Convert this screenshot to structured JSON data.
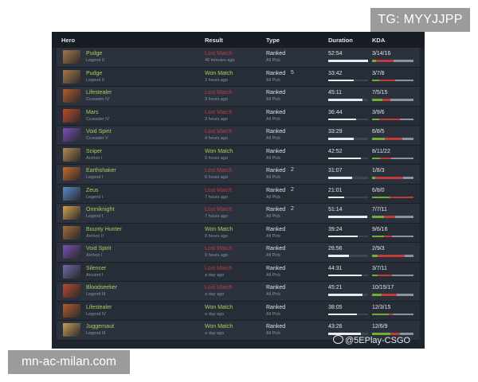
{
  "badges": {
    "tg": "TG: MYYJJPP",
    "site": "mn-ac-milan.com"
  },
  "watermark": "@5EPlay-CSGO",
  "table": {
    "headers": {
      "hero": "Hero",
      "result": "Result",
      "type": "Type",
      "duration": "Duration",
      "kda": "KDA"
    },
    "rows": [
      {
        "hero": "Pudge",
        "rank": "Legend II",
        "result": "Lost Match",
        "won": false,
        "when": "40 minutes ago",
        "type": "Ranked",
        "mode": "All Pick",
        "party": "",
        "duration": "52:54",
        "dur_frac": 1.0,
        "kda": "3/14/16",
        "k": 3,
        "d": 14,
        "a": 16,
        "color": "#a7774d"
      },
      {
        "hero": "Pudge",
        "rank": "Legend II",
        "result": "Won Match",
        "won": true,
        "when": "2 hours ago",
        "type": "Ranked",
        "mode": "All Pick",
        "party": "5",
        "duration": "33:42",
        "dur_frac": 0.64,
        "kda": "3/7/8",
        "k": 3,
        "d": 7,
        "a": 8,
        "color": "#a7774d"
      },
      {
        "hero": "Lifestealer",
        "rank": "Crusader IV",
        "result": "Lost Match",
        "won": false,
        "when": "3 hours ago",
        "type": "Ranked",
        "mode": "All Pick",
        "party": "",
        "duration": "45:11",
        "dur_frac": 0.85,
        "kda": "7/5/15",
        "k": 7,
        "d": 5,
        "a": 15,
        "color": "#b35a2c"
      },
      {
        "hero": "Mars",
        "rank": "Crusader IV",
        "result": "Lost Match",
        "won": false,
        "when": "3 hours ago",
        "type": "Ranked",
        "mode": "All Pick",
        "party": "",
        "duration": "36:44",
        "dur_frac": 0.69,
        "kda": "3/9/6",
        "k": 3,
        "d": 9,
        "a": 6,
        "color": "#c14a2a"
      },
      {
        "hero": "Void Spirit",
        "rank": "Crusader V",
        "result": "Lost Match",
        "won": false,
        "when": "4 hours ago",
        "type": "Ranked",
        "mode": "All Pick",
        "party": "",
        "duration": "33:29",
        "dur_frac": 0.63,
        "kda": "6/8/5",
        "k": 6,
        "d": 8,
        "a": 5,
        "color": "#7a4fb8"
      },
      {
        "hero": "Sniper",
        "rank": "Archon I",
        "result": "Won Match",
        "won": true,
        "when": "5 hours ago",
        "type": "Ranked",
        "mode": "All Pick",
        "party": "",
        "duration": "42:52",
        "dur_frac": 0.81,
        "kda": "8/11/22",
        "k": 8,
        "d": 11,
        "a": 22,
        "color": "#b38a56"
      },
      {
        "hero": "Earthshaker",
        "rank": "Legend I",
        "result": "Lost Match",
        "won": false,
        "when": "6 hours ago",
        "type": "Ranked",
        "mode": "All Pick",
        "party": "2",
        "duration": "31:07",
        "dur_frac": 0.59,
        "kda": "1/8/3",
        "k": 1,
        "d": 8,
        "a": 3,
        "color": "#c46b2c"
      },
      {
        "hero": "Zeus",
        "rank": "Legend I",
        "result": "Lost Match",
        "won": false,
        "when": "7 hours ago",
        "type": "Ranked",
        "mode": "All Pick",
        "party": "2",
        "duration": "21:01",
        "dur_frac": 0.4,
        "kda": "6/8/0",
        "k": 6,
        "d": 8,
        "a": 0,
        "color": "#5a8ac9"
      },
      {
        "hero": "Omniknight",
        "rank": "Legend I",
        "result": "Lost Match",
        "won": false,
        "when": "7 hours ago",
        "type": "Ranked",
        "mode": "All Pick",
        "party": "2",
        "duration": "51:14",
        "dur_frac": 0.97,
        "kda": "7/7/11",
        "k": 7,
        "d": 7,
        "a": 11,
        "color": "#d1a04e"
      },
      {
        "hero": "Bounty Hunter",
        "rank": "Archon II",
        "result": "Won Match",
        "won": true,
        "when": "8 hours ago",
        "type": "Ranked",
        "mode": "All Pick",
        "party": "",
        "duration": "39:24",
        "dur_frac": 0.74,
        "kda": "9/6/16",
        "k": 9,
        "d": 6,
        "a": 16,
        "color": "#a36a3a"
      },
      {
        "hero": "Void Spirit",
        "rank": "Archon I",
        "result": "Lost Match",
        "won": false,
        "when": "9 hours ago",
        "type": "Ranked",
        "mode": "All Pick",
        "party": "",
        "duration": "26:56",
        "dur_frac": 0.51,
        "kda": "2/9/3",
        "k": 2,
        "d": 9,
        "a": 3,
        "color": "#7a4fb8"
      },
      {
        "hero": "Silencer",
        "rank": "Ancient I",
        "result": "Lost Match",
        "won": false,
        "when": "a day ago",
        "type": "Ranked",
        "mode": "All Pick",
        "party": "",
        "duration": "44:31",
        "dur_frac": 0.84,
        "kda": "3/7/11",
        "k": 3,
        "d": 7,
        "a": 11,
        "color": "#6d6aa8"
      },
      {
        "hero": "Bloodseeker",
        "rank": "Legend III",
        "result": "Lost Match",
        "won": false,
        "when": "a day ago",
        "type": "Ranked",
        "mode": "All Pick",
        "party": "",
        "duration": "45:21",
        "dur_frac": 0.86,
        "kda": "10/15/17",
        "k": 10,
        "d": 15,
        "a": 17,
        "color": "#b8492e"
      },
      {
        "hero": "Lifestealer",
        "rank": "Legend IV",
        "result": "Won Match",
        "won": true,
        "when": "a day ago",
        "type": "Ranked",
        "mode": "All Pick",
        "party": "",
        "duration": "38:05",
        "dur_frac": 0.72,
        "kda": "12/3/15",
        "k": 12,
        "d": 3,
        "a": 15,
        "color": "#b35a2c"
      },
      {
        "hero": "Juggernaut",
        "rank": "Legend III",
        "result": "Won Match",
        "won": true,
        "when": "a day ago",
        "type": "Ranked",
        "mode": "All Pick",
        "party": "",
        "duration": "43:26",
        "dur_frac": 0.82,
        "kda": "12/6/9",
        "k": 12,
        "d": 6,
        "a": 9,
        "color": "#c79c5a"
      }
    ]
  },
  "colors": {
    "won": "#a8cf5e",
    "lost": "#c23b3b",
    "kills": "#6fae3a",
    "deaths": "#c23b3b",
    "assists": "#8a949f"
  },
  "icons": {
    "party_icon": "party-icon",
    "solo_icon": "solo-icon"
  }
}
